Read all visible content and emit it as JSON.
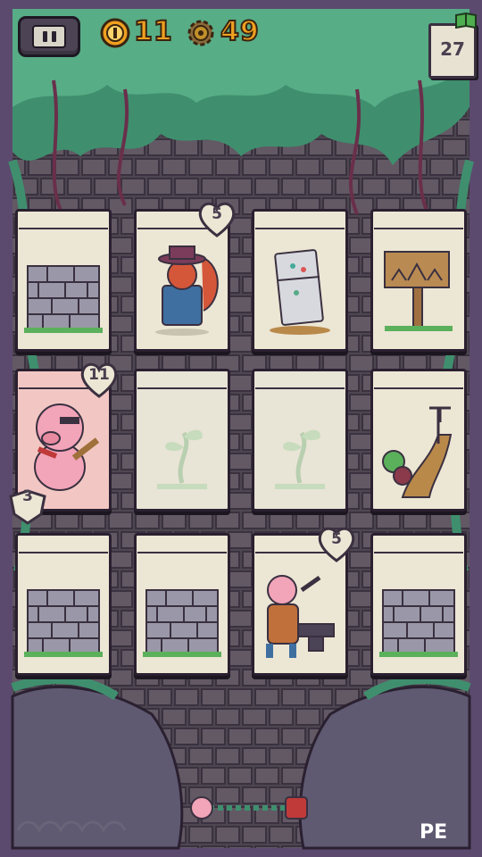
{
  "hud": {
    "coins": "11",
    "gears": "49",
    "journal_count": "27"
  },
  "cards": {
    "squirrel_hp": "5",
    "pig_hp": "11",
    "pig_armor": "3",
    "blacksmith_hp": "5"
  },
  "footer": {
    "badge": "PE"
  },
  "colors": {
    "hud_number": "#f0a020",
    "card_paper": "#ece6d4",
    "player_card": "#f2c7c3",
    "frame": "#2a2030",
    "foliage": "#3f8f6e"
  }
}
